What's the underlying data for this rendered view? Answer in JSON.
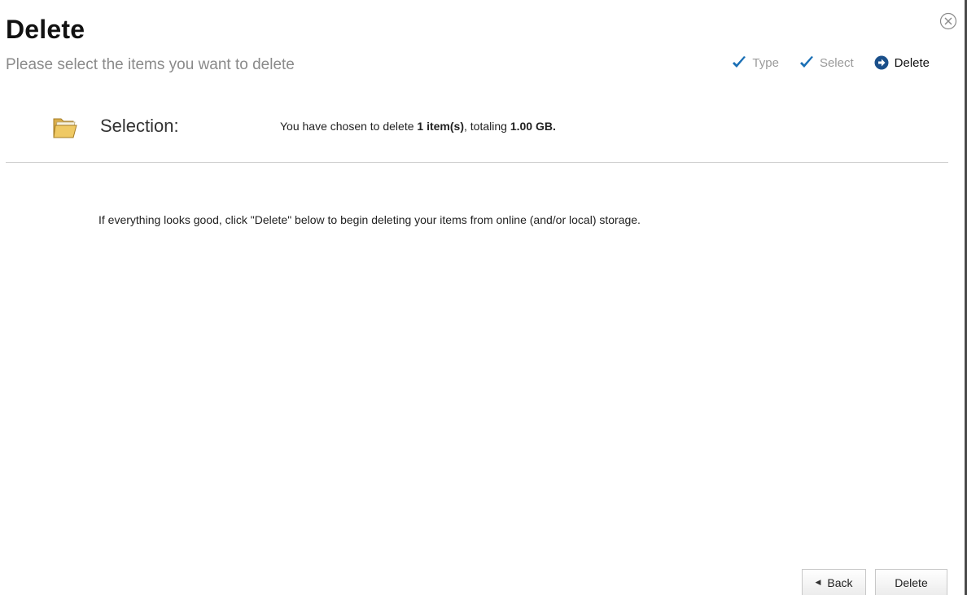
{
  "header": {
    "title": "Delete",
    "subtitle": "Please select the items you want to delete"
  },
  "steps": [
    {
      "label": "Type",
      "state": "done",
      "icon": "checkmark-icon"
    },
    {
      "label": "Select",
      "state": "done",
      "icon": "checkmark-icon"
    },
    {
      "label": "Delete",
      "state": "current",
      "icon": "arrow-circle-icon"
    }
  ],
  "selection": {
    "label": "Selection:",
    "text_prefix": "You have chosen to delete ",
    "count": "1 item(s)",
    "text_middle": ", totaling ",
    "size": "1.00 GB.",
    "icon": "folder-icon"
  },
  "instructions": "If everything looks good, click \"Delete\" below to begin deleting your items from online (and/or local) storage.",
  "buttons": {
    "back_label": "Back",
    "delete_label": "Delete"
  },
  "colors": {
    "accent": "#1a6fb5",
    "muted_text": "#8a8a8a",
    "folder": "#e8c46a"
  }
}
